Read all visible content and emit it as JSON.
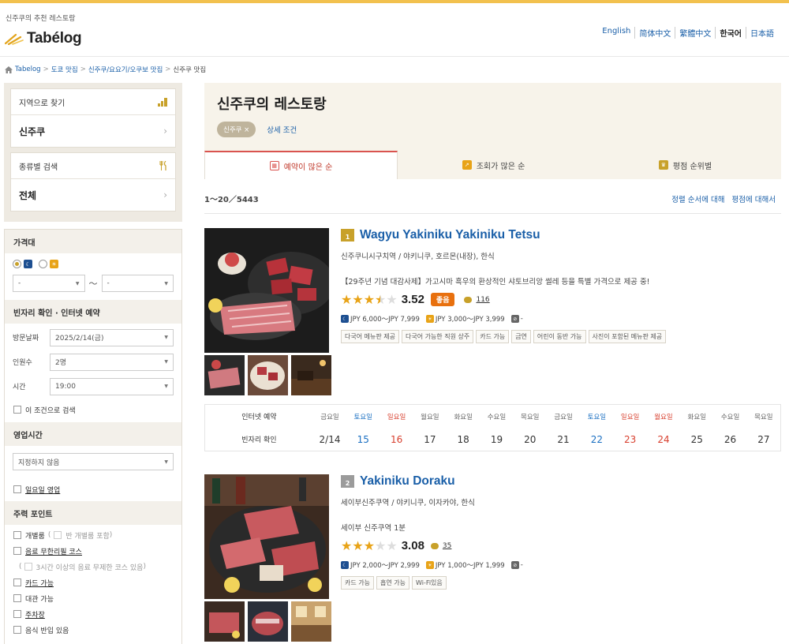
{
  "header": {
    "tagline": "신주쿠의 추천 레스토랑",
    "logo": "Tabélog",
    "languages": [
      {
        "label": "English",
        "active": false
      },
      {
        "label": "简体中文",
        "active": false
      },
      {
        "label": "繁體中文",
        "active": false
      },
      {
        "label": "한국어",
        "active": true
      },
      {
        "label": "日本語",
        "active": false
      }
    ]
  },
  "breadcrumb": [
    "Tabelog",
    "도쿄 맛집",
    "신주쿠/요요기/오쿠보 맛집",
    "신주쿠 맛집"
  ],
  "sidebar": {
    "area_search": {
      "label": "지역으로 찾기",
      "value": "신주쿠"
    },
    "genre_search": {
      "label": "종류별 검색",
      "value": "전체"
    },
    "price": {
      "heading": "가격대",
      "min_placeholder": "-",
      "max_placeholder": "-",
      "separator": "～"
    },
    "booking": {
      "heading": "빈자리 확인 · 인터넷 예약",
      "date_label": "방문날짜",
      "date_value": "2025/2/14(금)",
      "people_label": "인원수",
      "people_value": "2명",
      "time_label": "시간",
      "time_value": "19:00",
      "search_condition": "이 조건으로 검색"
    },
    "hours": {
      "heading": "영업시간",
      "select_value": "지정하지 않음",
      "sunday_open": "일요일 영업"
    },
    "features": {
      "heading": "주력 포인트",
      "private_room": "개별룸",
      "private_room_note_open": "(",
      "private_room_note": "반 개별룸 포함",
      "private_room_note_close": ")",
      "all_you_can_drink": "음료 무한리필 코스",
      "ayd_note_open": "(",
      "ayd_note": "3시간 이상의 음료 무제한 코스 있음",
      "ayd_note_close": ")",
      "card": "카드 가능",
      "charter": "대관 가능",
      "parking": "주차장",
      "more": "음식 반입 있음"
    }
  },
  "main": {
    "title": "신주쿠의 레스토랑",
    "chip": "신주쿠 ×",
    "detail_link": "상세 조건",
    "tabs": [
      "예약이 많은 순",
      "조회가 많은 순",
      "평점 순위별"
    ],
    "count": "1～20／5443",
    "sort_links": [
      "정렬 순서에 대해",
      "평점에 대해서"
    ]
  },
  "restaurants": [
    {
      "rank": "1",
      "name": "Wagyu Yakiniku Yakiniku Tetsu",
      "area": "신주쿠니시구치역 / 야키니쿠, 호르몬(내장), 한식",
      "pr": "【29주년 기념 대감사제】가고시마 흑우의 환상적인 샤토브리앙 썰레 등을 특별 가격으로 제공 중!",
      "score": "3.52",
      "stars": 3.5,
      "badge": "좋음",
      "reviews": "116",
      "dinner_price": "JPY 6,000～JPY 7,999",
      "lunch_price": "JPY 3,000～JPY 3,999",
      "holiday": "-",
      "tags": [
        "다국어 메뉴판 제공",
        "다국어 가능한 직원 상주",
        "카드 가능",
        "금연",
        "어린이 동반 가능",
        "사진이 포함된 메뉴판 제공"
      ]
    },
    {
      "rank": "2",
      "name": "Yakiniku Doraku",
      "area": "세이부신주쿠역 / 야키니쿠, 이자카야, 한식",
      "pr": "세이부 신주쿠역 1분",
      "score": "3.08",
      "stars": 3,
      "badge": "",
      "reviews": "35",
      "dinner_price": "JPY 2,000～JPY 2,999",
      "lunch_price": "JPY 1,000～JPY 1,999",
      "holiday": "-",
      "tags": [
        "카드 가능",
        "흡연 가능",
        "Wi-Fi있음"
      ]
    }
  ],
  "calendar": {
    "label_top": "인터넷 예약",
    "label_bottom": "빈자리 확인",
    "days": [
      {
        "dow": "금요일",
        "date": "2/14",
        "type": "weekday"
      },
      {
        "dow": "토요일",
        "date": "15",
        "type": "sat"
      },
      {
        "dow": "일요일",
        "date": "16",
        "type": "sun"
      },
      {
        "dow": "월요일",
        "date": "17",
        "type": "weekday"
      },
      {
        "dow": "화요일",
        "date": "18",
        "type": "weekday"
      },
      {
        "dow": "수요일",
        "date": "19",
        "type": "weekday"
      },
      {
        "dow": "목요일",
        "date": "20",
        "type": "weekday"
      },
      {
        "dow": "금요일",
        "date": "21",
        "type": "weekday"
      },
      {
        "dow": "토요일",
        "date": "22",
        "type": "sat"
      },
      {
        "dow": "일요일",
        "date": "23",
        "type": "sun"
      },
      {
        "dow": "월요일",
        "date": "24",
        "type": "sun"
      },
      {
        "dow": "화요일",
        "date": "25",
        "type": "weekday"
      },
      {
        "dow": "수요일",
        "date": "26",
        "type": "weekday"
      },
      {
        "dow": "목요일",
        "date": "27",
        "type": "weekday"
      }
    ]
  },
  "colors": {
    "accent_gold": "#c8a12a",
    "link_blue": "#1a5fa8",
    "active_tab_red": "#d9534f",
    "badge_orange": "#e8700e",
    "star": "#e8a317"
  }
}
